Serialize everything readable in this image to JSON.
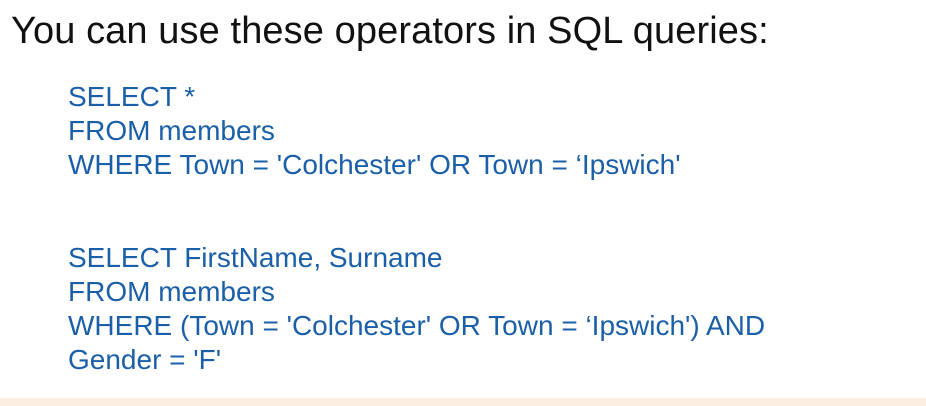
{
  "heading": "You can use these operators in SQL queries:",
  "queries": [
    {
      "lines": [
        "SELECT *",
        "FROM members",
        "WHERE Town = 'Colchester' OR Town = ‘Ipswich'"
      ]
    },
    {
      "lines": [
        "SELECT FirstName, Surname",
        "FROM members",
        "WHERE (Town = 'Colchester' OR Town = ‘Ipswich') AND",
        "Gender = 'F'"
      ]
    }
  ],
  "colors": {
    "heading_text": "#111111",
    "code_text": "#1b5fa8",
    "background": "#ffffff",
    "bottom_band": "#fbeee0"
  }
}
